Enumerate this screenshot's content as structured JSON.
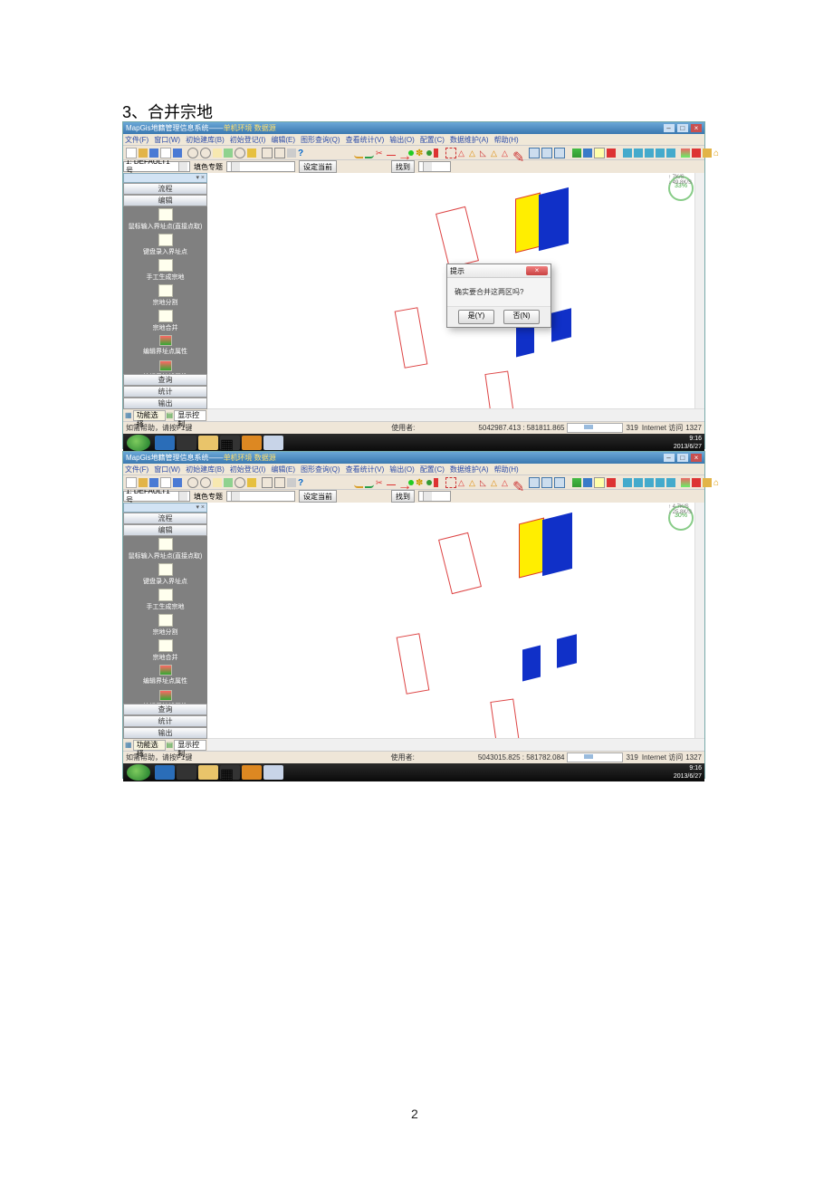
{
  "document": {
    "heading": "3、合并宗地",
    "page_number": "2"
  },
  "app": {
    "title_prefix": "MapGis地籍管理信息系统——",
    "title_suffix": "单机环境  数据源",
    "window_buttons": {
      "min": "–",
      "max": "□",
      "close": "×"
    },
    "menus": [
      "文件(F)",
      "窗口(W)",
      "初始建库(B)",
      "初始登记(I)",
      "编辑(E)",
      "图形查询(Q)",
      "查看统计(V)",
      "输出(O)",
      "配置(C)",
      "数据维护(A)",
      "帮助(H)"
    ],
    "combo_selected": "1: DEFAULT1号",
    "combo_label": "填色专题",
    "btn_setcur": "设定当前",
    "btn_find": "找到",
    "sidebar": {
      "header_close": "▾ ×",
      "buttons_top": [
        "流程",
        "编辑"
      ],
      "items": [
        "鼠标输入界址点(直接点取)",
        "键盘录入界址点",
        "手工生成宗地",
        "宗地分割",
        "宗地合并",
        "编辑界址点属性",
        "编辑界址线属性"
      ],
      "buttons_bottom": [
        "查询",
        "统计",
        "输出"
      ],
      "tabs": {
        "func": "功能选择",
        "disp": "显示控制"
      }
    },
    "status": {
      "help_hint": "如需帮助，请按F1键",
      "user_label": "使用者:",
      "zoom_val": "319",
      "net_label": "Internet 访问",
      "port": "1327"
    },
    "taskbar": {
      "time": "9:16",
      "date": "2013/6/27"
    }
  },
  "shot1": {
    "cpu_pct": "33%",
    "rate1": "7K/S",
    "rate2": "49.8K/S",
    "coords": "5042987.413 : 581811.865",
    "dialog": {
      "title": "提示",
      "message": "确实要合并这两区吗?",
      "yes": "是(Y)",
      "no": "否(N)"
    }
  },
  "shot2": {
    "cpu_pct": "30%",
    "rate1": "4.7K/S",
    "rate2": "25.8K/S",
    "coords": "5043015.825 : 581782.084"
  }
}
